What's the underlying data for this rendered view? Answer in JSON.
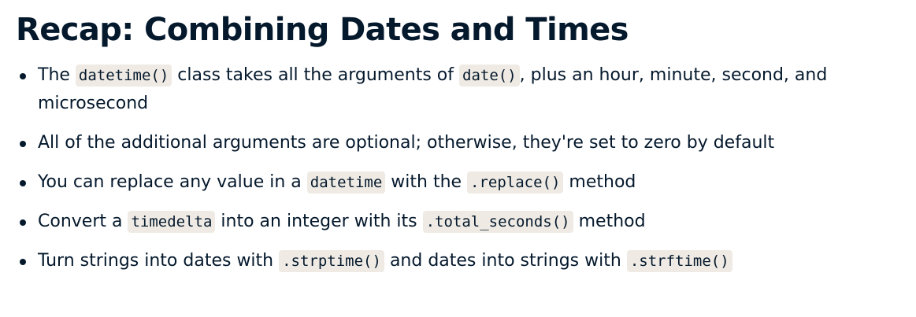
{
  "slide": {
    "title": "Recap: Combining Dates and Times",
    "bullets": [
      {
        "parts": [
          {
            "type": "text",
            "value": "The "
          },
          {
            "type": "code",
            "value": "datetime()"
          },
          {
            "type": "text",
            "value": " class takes all the arguments of "
          },
          {
            "type": "code",
            "value": "date()"
          },
          {
            "type": "text",
            "value": ", plus an hour, minute, second, and microsecond"
          }
        ]
      },
      {
        "parts": [
          {
            "type": "text",
            "value": "All of the additional arguments are optional; otherwise, they're set to zero by default"
          }
        ]
      },
      {
        "parts": [
          {
            "type": "text",
            "value": "You can replace any value in a "
          },
          {
            "type": "code",
            "value": "datetime"
          },
          {
            "type": "text",
            "value": " with the "
          },
          {
            "type": "code",
            "value": ".replace()"
          },
          {
            "type": "text",
            "value": " method"
          }
        ]
      },
      {
        "parts": [
          {
            "type": "text",
            "value": "Convert a "
          },
          {
            "type": "code",
            "value": "timedelta"
          },
          {
            "type": "text",
            "value": " into an integer with its "
          },
          {
            "type": "code",
            "value": ".total_seconds()"
          },
          {
            "type": "text",
            "value": " method"
          }
        ]
      },
      {
        "parts": [
          {
            "type": "text",
            "value": "Turn strings into dates with "
          },
          {
            "type": "code",
            "value": ".strptime()"
          },
          {
            "type": "text",
            "value": " and dates into strings with "
          },
          {
            "type": "code",
            "value": ".strftime()"
          }
        ]
      }
    ]
  }
}
